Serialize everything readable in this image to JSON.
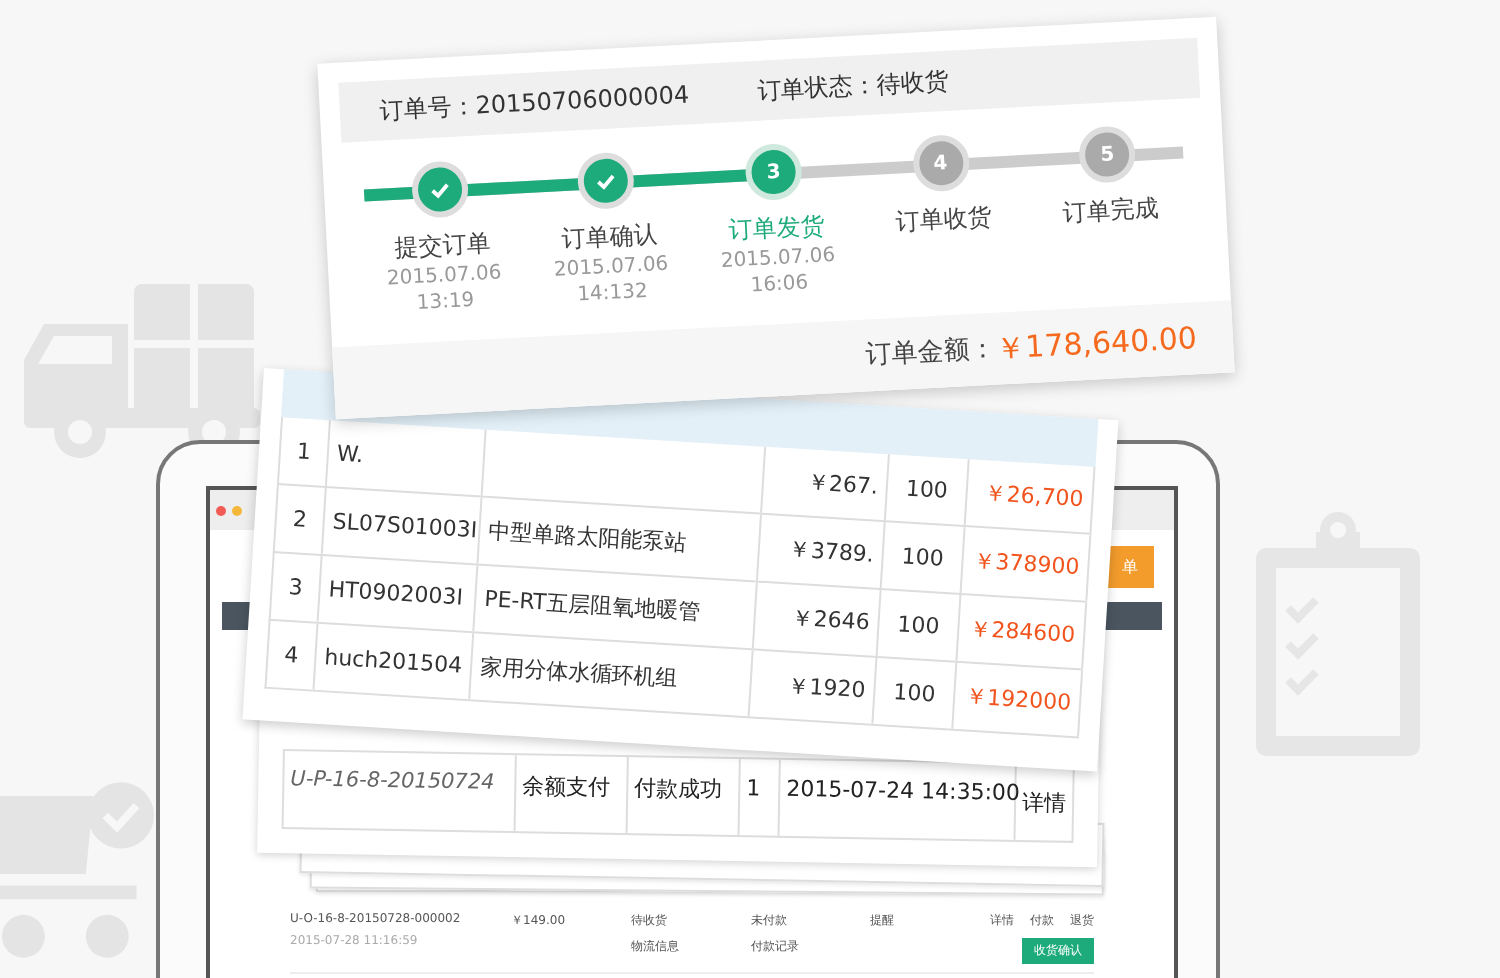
{
  "order_card": {
    "order_number": "订单号：20150706000004",
    "order_status": "订单状态：待收货",
    "steps": [
      {
        "label": "提交订单",
        "date": "2015.07.06",
        "time": "13:19",
        "done": true,
        "selected": false
      },
      {
        "label": "订单确认",
        "date": "2015.07.06",
        "time": "14:132",
        "done": true,
        "selected": false
      },
      {
        "number": "3",
        "label": "订单发货",
        "date": "2015.07.06",
        "time": "16:06",
        "done": false,
        "selected": true
      },
      {
        "number": "4",
        "label": "订单收货",
        "done": false,
        "selected": false
      },
      {
        "number": "5",
        "label": "订单完成",
        "done": false,
        "selected": false
      }
    ],
    "total_label": "订单金额：",
    "total_value": "￥178,640.00"
  },
  "items_table": {
    "rows": [
      {
        "index": "1",
        "code": "W.",
        "name": "",
        "price": "￥267.",
        "qty": "100",
        "subtotal": "￥26,700"
      },
      {
        "index": "2",
        "code": "SL07S01003I",
        "name": "中型单路太阳能泵站",
        "price": "￥3789.",
        "qty": "100",
        "subtotal": "￥378900"
      },
      {
        "index": "3",
        "code": "HT0902003I",
        "name": "PE-RT五层阻氧地暖管",
        "price": "￥2646",
        "qty": "100",
        "subtotal": "￥284600"
      },
      {
        "index": "4",
        "code": "huch201504",
        "name": "家用分体水循环机组",
        "price": "￥1920",
        "qty": "100",
        "subtotal": "￥192000"
      }
    ]
  },
  "payment_row": {
    "cells": [
      "U-P-16-8-20150724",
      "余额支付",
      "付款成功",
      "1",
      "2015-07-24 14:35:00",
      "详情"
    ]
  },
  "laptop_screen": {
    "orange_button": "单",
    "order_row": {
      "number": "U-O-16-8-20150728-000002",
      "date": "2015-07-28 11:16:59",
      "amount": "￥149.00",
      "status": "待收货",
      "logistics": "物流信息",
      "payment": "未付款",
      "payment_record": "付款记录",
      "remind": "提醒",
      "actions": [
        "详情",
        "付款",
        "退货"
      ],
      "confirm": "收货确认"
    }
  }
}
